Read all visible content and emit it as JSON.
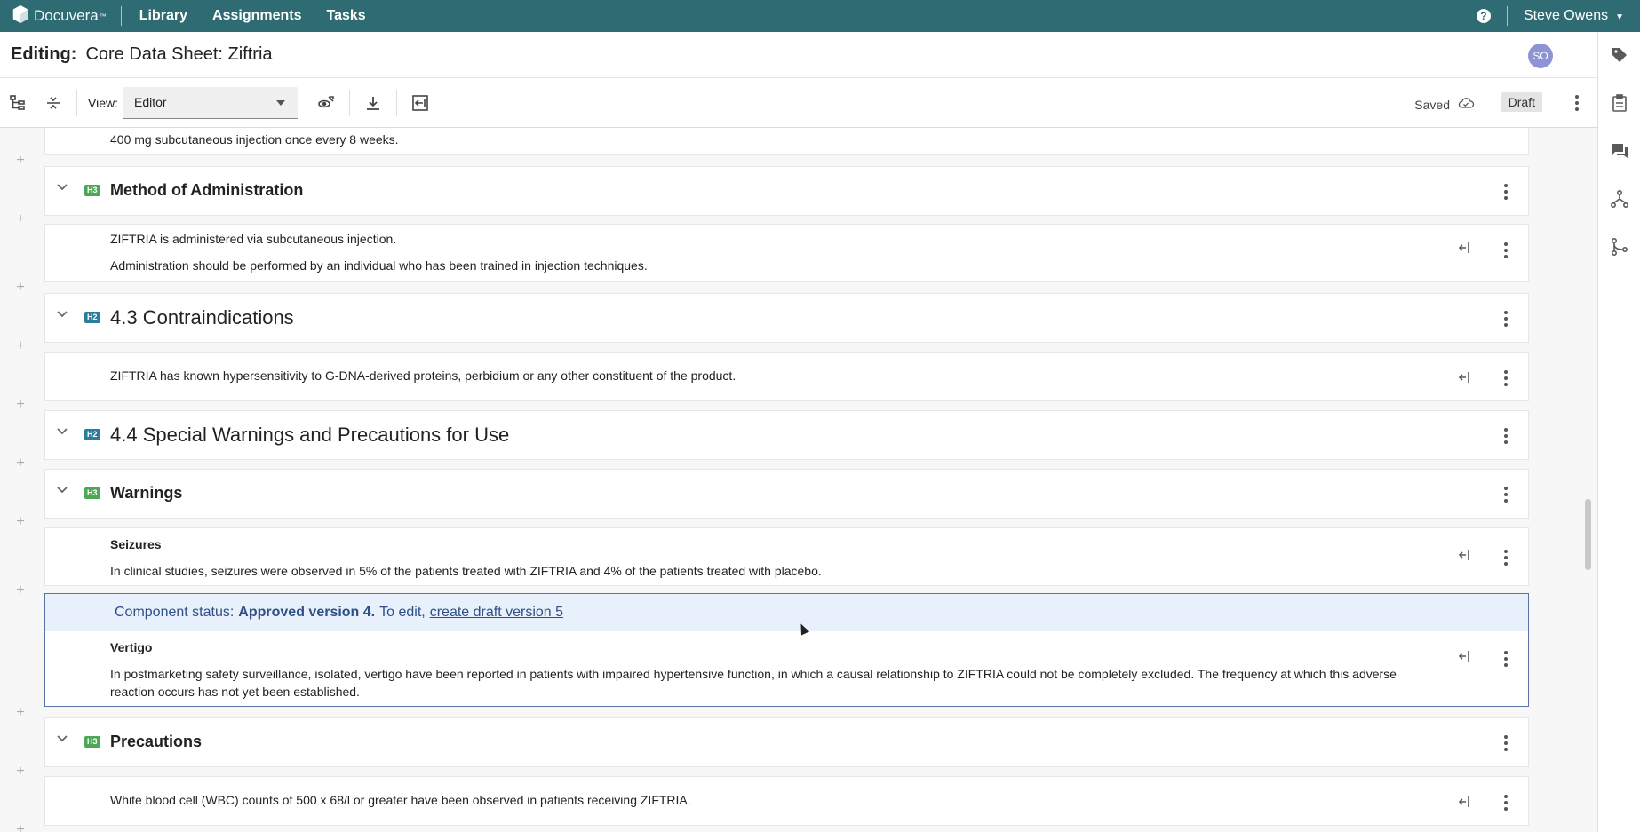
{
  "topbar": {
    "brand": "Docuvera",
    "brand_tm": "™",
    "nav": [
      "Library",
      "Assignments",
      "Tasks"
    ],
    "help": "?",
    "user": "Steve Owens"
  },
  "title": {
    "label": "Editing:",
    "document": "Core Data Sheet: Ziftria",
    "avatar": "SO"
  },
  "toolbar": {
    "view_label": "View:",
    "view_value": "Editor",
    "saved": "Saved",
    "draft": "Draft"
  },
  "content": {
    "top_para": "400 mg subcutaneous injection once every 8 weeks.",
    "method_badge": "H3",
    "method_heading": "Method of Administration",
    "method_para1": "ZIFTRIA is administered via subcutaneous injection.",
    "method_para2": "Administration should be performed by an individual who has been trained in injection techniques.",
    "contra_badge": "H2",
    "contra_heading": "4.3 Contraindications",
    "contra_para": "ZIFTRIA has known hypersensitivity to G-DNA-derived proteins, perbidium or any other constituent of the product.",
    "special_badge": "H2",
    "special_heading": "4.4 Special Warnings and Precautions for Use",
    "warnings_badge": "H3",
    "warnings_heading": "Warnings",
    "seizures_title": "Seizures",
    "seizures_para": "In clinical studies, seizures were observed in 5% of the patients treated with ZIFTRIA and 4% of the patients treated with placebo.",
    "status_prefix": "Component status:",
    "status_value": "Approved version 4.",
    "status_mid": "To edit,",
    "status_link": "create draft version 5",
    "vertigo_title": "Vertigo",
    "vertigo_para": "In postmarketing safety surveillance, isolated, vertigo have been reported in patients with impaired hypertensive function, in which a causal relationship to ZIFTRIA could not be completely excluded. The frequency at which this adverse reaction occurs has not yet been established.",
    "precautions_badge": "H3",
    "precautions_heading": "Precautions",
    "wbc_para": "White blood cell (WBC) counts of 500 x 68/l or greater have been observed in patients receiving ZIFTRIA."
  },
  "icons": {
    "brand_logo": "hexagon-logo-icon",
    "rail": [
      "tag-icon",
      "clipboard-icon",
      "comments-icon",
      "workflow-icon",
      "branch-icon"
    ]
  }
}
